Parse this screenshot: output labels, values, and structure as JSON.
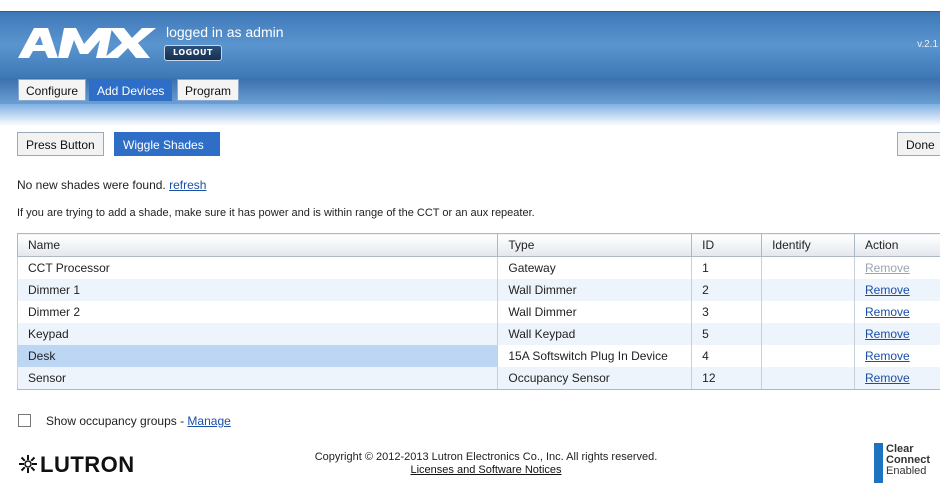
{
  "header": {
    "logo_alt": "AMX",
    "logged_in": "logged in as admin",
    "logout_label": "LOGOUT",
    "version": "v.2.1"
  },
  "tabs": [
    {
      "label": "Configure",
      "active": false
    },
    {
      "label": "Add Devices",
      "active": true
    },
    {
      "label": "Program",
      "active": false
    }
  ],
  "actions": {
    "press_button": "Press Button",
    "wiggle_shades": "Wiggle Shades",
    "done": "Done"
  },
  "messages": {
    "no_shades": "No  new shades were found.",
    "refresh": "refresh",
    "hint": "If you are trying to add a shade, make sure it has power and is within range of the CCT or an aux repeater."
  },
  "table": {
    "headers": [
      "Name",
      "Type",
      "ID",
      "Identify",
      "Action"
    ],
    "rows": [
      {
        "name": "CCT Processor",
        "type": "Gateway",
        "id": "1",
        "identify": "",
        "action": "Remove",
        "action_enabled": false
      },
      {
        "name": "Dimmer 1",
        "type": "Wall Dimmer",
        "id": "2",
        "identify": "",
        "action": "Remove",
        "action_enabled": true
      },
      {
        "name": "Dimmer 2",
        "type": "Wall Dimmer",
        "id": "3",
        "identify": "",
        "action": "Remove",
        "action_enabled": true
      },
      {
        "name": "Keypad",
        "type": "Wall Keypad",
        "id": "5",
        "identify": "",
        "action": "Remove",
        "action_enabled": true
      },
      {
        "name": "Desk",
        "type": "15A Softswitch Plug In Device",
        "id": "4",
        "identify": "",
        "action": "Remove",
        "action_enabled": true
      },
      {
        "name": "Sensor",
        "type": "Occupancy Sensor",
        "id": "12",
        "identify": "",
        "action": "Remove",
        "action_enabled": true
      }
    ]
  },
  "occupancy": {
    "label": "Show occupancy groups - ",
    "manage": "Manage",
    "checked": false
  },
  "footer": {
    "brand": "LUTRON",
    "copyright": "Copyright © 2012-2013 Lutron Electronics Co., Inc. All rights reserved.",
    "licenses": "Licenses and Software Notices",
    "clear_connect": [
      "Clear",
      "Connect",
      "Enabled"
    ]
  },
  "colors": {
    "header_blue": "#3e78b8",
    "active_tab": "#2f6ec7",
    "link": "#1a4fa6",
    "row_alt": "#eef4fb",
    "row_selected": "#bcd6f3"
  }
}
